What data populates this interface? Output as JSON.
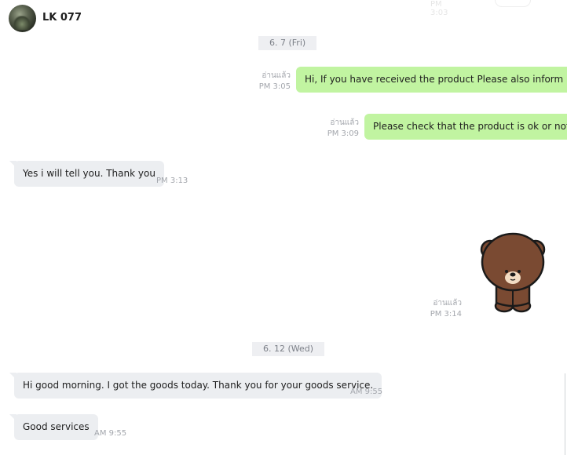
{
  "header": {
    "contact_name": "LK 077",
    "faded_time": "PM 3:03"
  },
  "colors": {
    "outgoing_bubble": "#c1f4a1",
    "incoming_bubble": "#eceef1",
    "date_chip": "#eceef1",
    "meta_text": "#a3a6ac"
  },
  "messages": [
    {
      "type": "date",
      "text": "6. 7 (Fri)"
    },
    {
      "type": "out",
      "text": "Hi, If you have received the product Please also inform us.",
      "read": "อ่านแล้ว",
      "time": "PM 3:05"
    },
    {
      "type": "out",
      "text": "Please check that the product is ok or not.",
      "read": "อ่านแล้ว",
      "time": "PM 3:09"
    },
    {
      "type": "in",
      "text": "Yes i will tell you. Thank you",
      "time": "PM 3:13"
    },
    {
      "type": "sticker",
      "icon": "brown-bear-sticker",
      "read": "อ่านแล้ว",
      "time": "PM 3:14"
    },
    {
      "type": "date",
      "text": "6. 12 (Wed)"
    },
    {
      "type": "in",
      "text": "Hi good morning. I got the goods today. Thank you for your goods service.",
      "time": "AM 9:55"
    },
    {
      "type": "in",
      "text": "Good services",
      "time": "AM 9:55"
    }
  ]
}
